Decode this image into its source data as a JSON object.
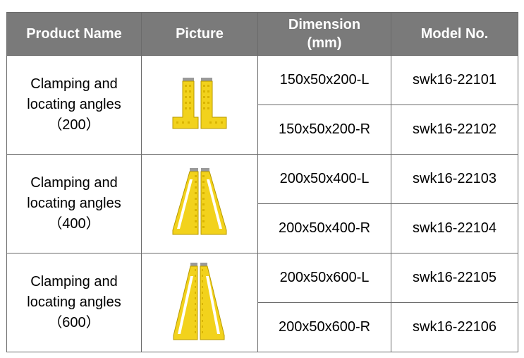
{
  "header": {
    "product_name": "Product Name",
    "picture": "Picture",
    "dimension_line1": "Dimension",
    "dimension_line2": "(mm)",
    "model_no": "Model No."
  },
  "groups": [
    {
      "name_line1": "Clamping and",
      "name_line2": "locating angles",
      "name_line3": "（200）",
      "picture": "clamping-angle-200-image",
      "rows": [
        {
          "dimension": "150x50x200-L",
          "model": "swk16-22101"
        },
        {
          "dimension": "150x50x200-R",
          "model": "swk16-22102"
        }
      ]
    },
    {
      "name_line1": "Clamping and",
      "name_line2": "locating angles",
      "name_line3": "（400）",
      "picture": "clamping-angle-400-image",
      "rows": [
        {
          "dimension": "200x50x400-L",
          "model": "swk16-22103"
        },
        {
          "dimension": "200x50x400-R",
          "model": "swk16-22104"
        }
      ]
    },
    {
      "name_line1": "Clamping and",
      "name_line2": "locating angles",
      "name_line3": "（600）",
      "picture": "clamping-angle-600-image",
      "rows": [
        {
          "dimension": "200x50x600-L",
          "model": "swk16-22105"
        },
        {
          "dimension": "200x50x600-R",
          "model": "swk16-22106"
        }
      ]
    }
  ],
  "colors": {
    "header_bg": "#7a7a7a",
    "header_text": "#ffffff",
    "border": "#6b6b6b",
    "part_yellow": "#f2d21c",
    "part_top": "#9a9a9a"
  }
}
